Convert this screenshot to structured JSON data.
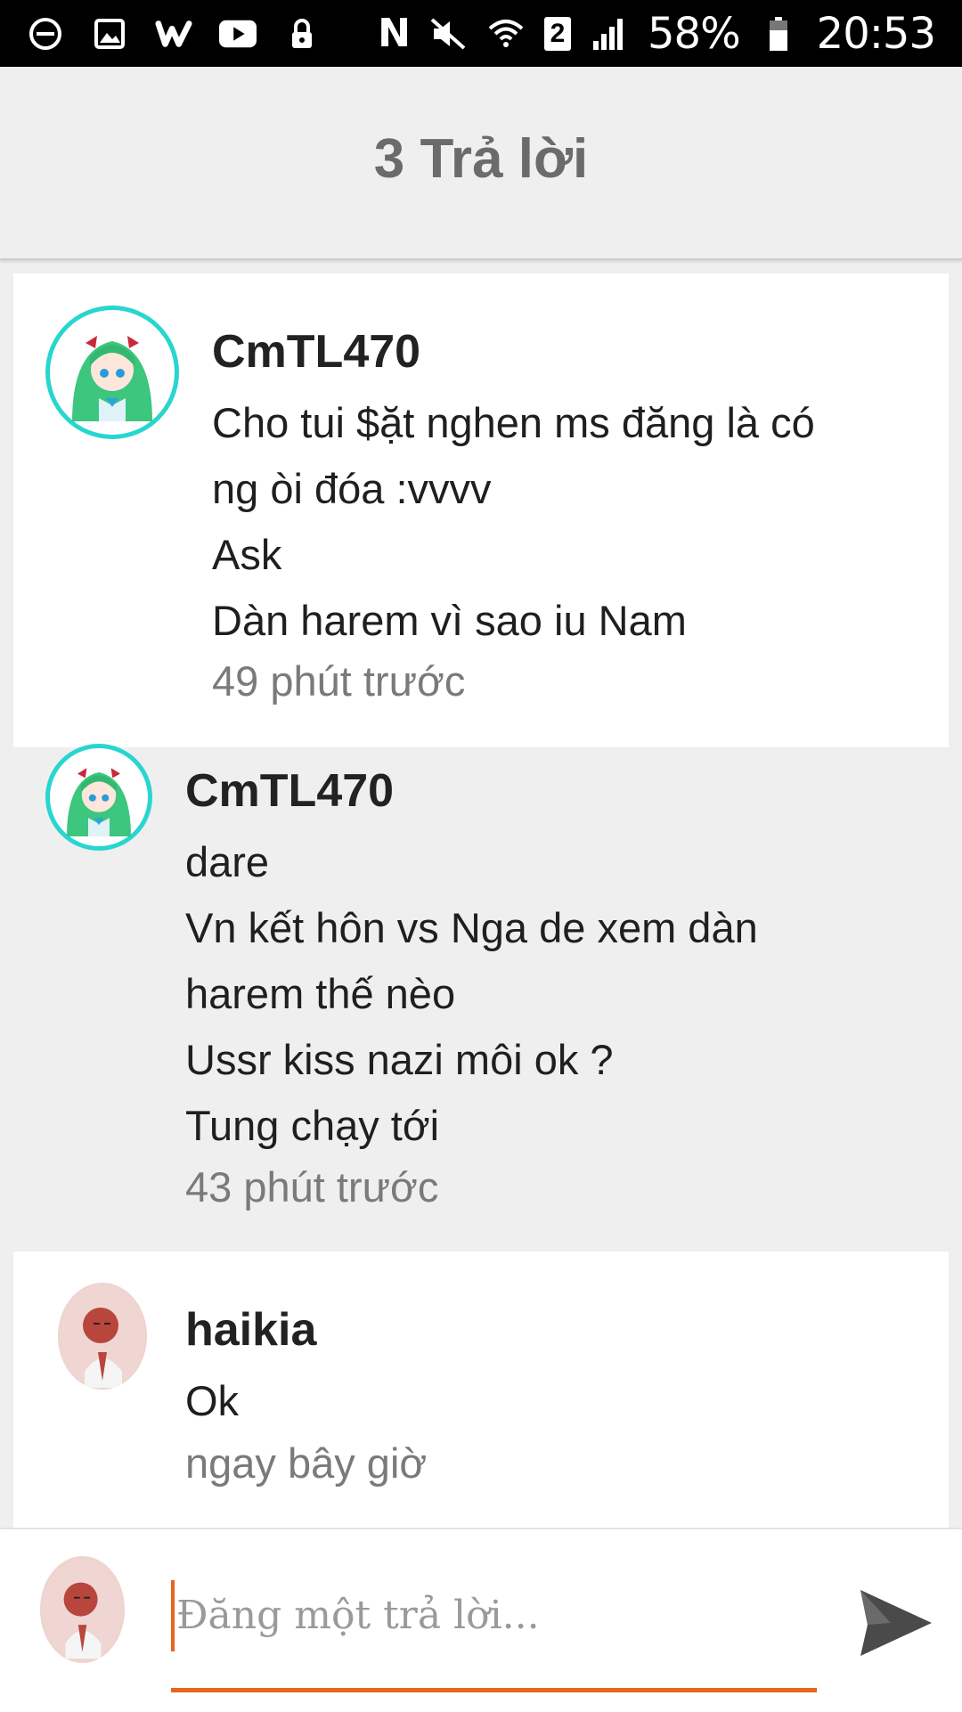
{
  "status_bar": {
    "battery": "58%",
    "time": "20:53",
    "sim_slot": "2",
    "nfc": "N"
  },
  "header": {
    "title": "3 Trả lời"
  },
  "comments": [
    {
      "author": "CmTL470",
      "lines": [
        "Cho tui $ặt nghen ms đăng là có",
        "ng òi đóa :vvvv",
        "Ask",
        "Dàn harem vì sao iu Nam"
      ],
      "time": "49 phút trước"
    },
    {
      "author": "CmTL470",
      "lines": [
        "dare",
        "Vn kết hôn vs Nga de xem dàn",
        "harem thế nèo",
        "Ussr kiss nazi môi ok ?",
        "Tung chạy tới"
      ],
      "time": "43 phút trước"
    },
    {
      "author": "haikia",
      "lines": [
        "Ok"
      ],
      "time": "ngay bây giờ"
    }
  ],
  "reply": {
    "placeholder": "Đăng một trả lời..."
  },
  "colors": {
    "accent": "#e8641f",
    "avatar_ring": "#28d6cf",
    "header_text": "#6b6b6b"
  }
}
